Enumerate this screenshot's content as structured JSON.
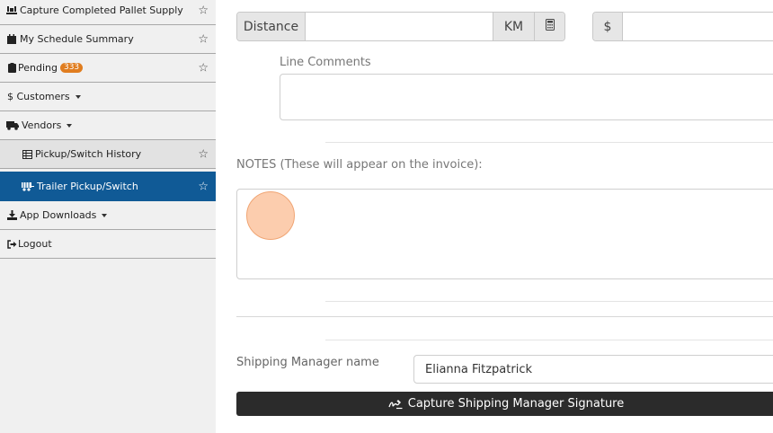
{
  "sidebar": {
    "items": [
      {
        "label": "Capture Completed Pallet Supply",
        "icon": "pallet-icon",
        "starred": "☆"
      },
      {
        "label": "My Schedule Summary",
        "icon": "calendar-icon",
        "starred": "☆"
      },
      {
        "label": "Pending",
        "icon": "clipboard-icon",
        "badge": "333",
        "starred": "☆"
      },
      {
        "label": "$ Customers",
        "icon": "caret-down-icon"
      },
      {
        "label": "Vendors",
        "icon": "truck-icon"
      },
      {
        "label": "Pickup/Switch History",
        "icon": "table-icon",
        "starred": "☆"
      },
      {
        "label": "Trailer Pickup/Switch",
        "icon": "trailer-icon",
        "starred": "☆"
      },
      {
        "label": "App Downloads",
        "icon": "download-icon"
      },
      {
        "label": "Logout",
        "icon": "logout-icon"
      }
    ]
  },
  "form": {
    "distance_label": "Distance",
    "distance_value": "",
    "unit_label": "KM",
    "calculator_icon": "calculator-icon",
    "currency_label": "$",
    "currency_value": "",
    "line_comments_label": "Line Comments",
    "line_comments_value": "",
    "notes_label": "NOTES (These will appear on the invoice):",
    "notes_value": "",
    "shipping_manager_label": "Shipping Manager name",
    "shipping_manager_value": "Elianna Fitzpatrick",
    "capture_signature_label": "Capture Shipping Manager Signature"
  },
  "colors": {
    "active_nav": "#105a96",
    "badge": "#e07d1f",
    "dark_button": "#2b2b2b"
  }
}
